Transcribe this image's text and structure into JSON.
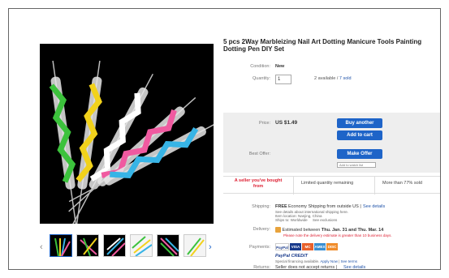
{
  "product": {
    "title": "5 pcs 2Way Marbleizing Nail Art Dotting Manicure Tools Painting Dotting Pen DIY Set",
    "condition_label": "Condition:",
    "condition_value": "New",
    "quantity_label": "Quantity:",
    "quantity_value": "1",
    "available_text": "2 available /",
    "sold_text": "7 sold",
    "price_label": "Price:",
    "price_value": "US $1.49",
    "best_offer_label": "Best Offer:",
    "add_to_watch": "Add to watch list"
  },
  "buttons": {
    "buy_another": "Buy another",
    "add_to_cart": "Add to cart",
    "make_offer": "Make Offer"
  },
  "highlights": {
    "bought_line1": "A seller you've bought",
    "bought_line2": "from",
    "limited": "Limited quantity remaining",
    "sold_pct": "More than 77% sold"
  },
  "shipping": {
    "label": "Shipping:",
    "value": "FREE",
    "method": "Economy Shipping from outside US |",
    "see_details": "See details",
    "note1": "See details about international shipping here.",
    "note2": "Item location:  Nanjing, China",
    "note3": "Ships to:  Worldwide",
    "see_exclusions": "See exclusions"
  },
  "delivery": {
    "label": "Delivery:",
    "estimated": "Estimated between",
    "dates": "Thu. Jan. 31 and Thu. Mar. 14",
    "note": "Please note the delivery estimate is greater than 10 business days."
  },
  "payments": {
    "label": "Payments:",
    "methods": [
      "PayPal",
      "VISA",
      "MC",
      "AMEX",
      "DISC"
    ],
    "paypal_credit": "PayPal CREDIT",
    "credit_note": "Special financing available.",
    "apply_now": "Apply Now",
    "see_terms": "See terms"
  },
  "returns": {
    "label": "Returns:",
    "value": "Seller does not accept returns |",
    "see_details": "See details"
  },
  "colors": {
    "accent_blue": "#1e64c8",
    "red": "#dd1e31",
    "price_box": "#eeeeee"
  }
}
